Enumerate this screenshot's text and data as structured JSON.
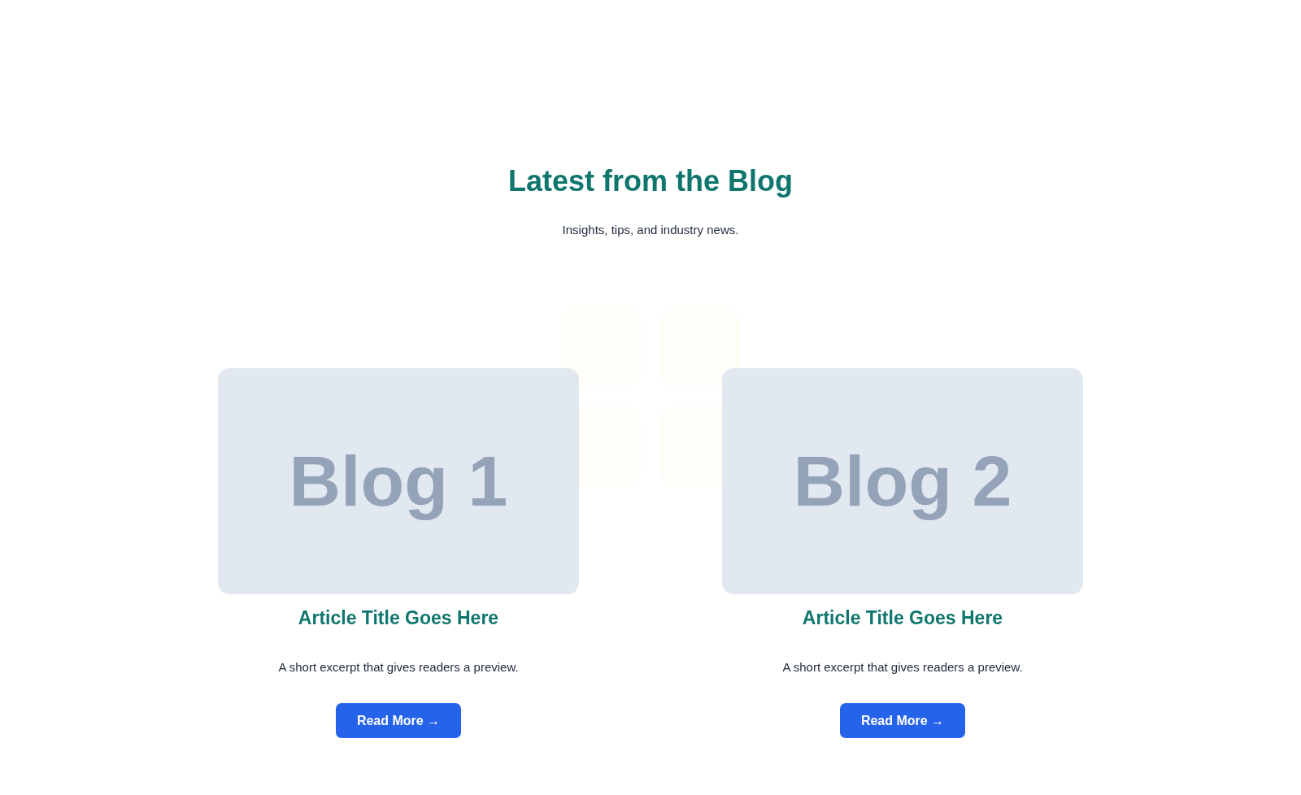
{
  "section": {
    "title": "Latest from the Blog",
    "subtitle": "Insights, tips, and industry news."
  },
  "posts": [
    {
      "image_label": "Blog 1",
      "title": "Article Title Goes Here",
      "excerpt": "A short excerpt that gives readers a preview.",
      "button": "Read More →"
    },
    {
      "image_label": "Blog 2",
      "title": "Article Title Goes Here",
      "excerpt": "A short excerpt that gives readers a preview.",
      "button": "Read More →"
    }
  ]
}
